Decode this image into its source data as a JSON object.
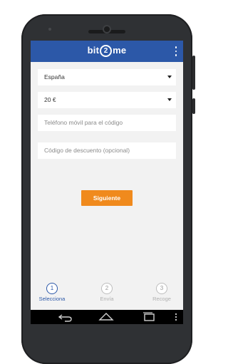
{
  "app": {
    "logo_prefix": "bit",
    "logo_number": "2",
    "logo_suffix": "me",
    "menu_icon": "more-vert-icon"
  },
  "form": {
    "country_select_value": "España",
    "amount_select_value": "20 €",
    "phone_placeholder": "Teléfono móvil para el código",
    "discount_placeholder": "Código de descuento (opcional)",
    "submit_label": "Siguiente"
  },
  "steps": [
    {
      "number": "1",
      "label": "Selecciona",
      "active": true
    },
    {
      "number": "2",
      "label": "Envía",
      "active": false
    },
    {
      "number": "3",
      "label": "Recoge",
      "active": false
    }
  ],
  "navbar": {
    "icons": [
      "back-icon",
      "home-icon",
      "recents-icon",
      "more-vert-icon"
    ]
  },
  "colors": {
    "app_bar": "#2c58a8",
    "accent_button": "#f08a1d",
    "active_step": "#2c58a8",
    "phone_body": "#2f3134"
  }
}
